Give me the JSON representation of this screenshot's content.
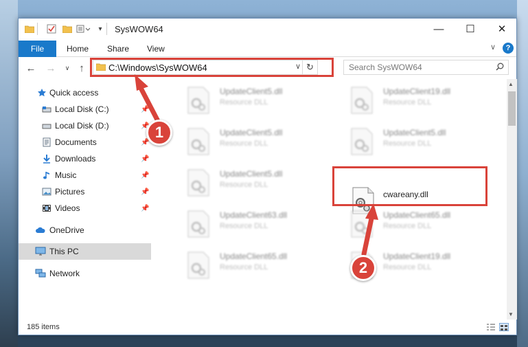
{
  "window": {
    "title": "SysWOW64",
    "controls": {
      "minimize": "—",
      "maximize": "☐",
      "close": "✕"
    }
  },
  "ribbon": {
    "file": "File",
    "tabs": [
      "Home",
      "Share",
      "View"
    ],
    "expand": "∨",
    "help": "?"
  },
  "nav": {
    "back": "←",
    "forward": "→",
    "recent": "∨",
    "up": "↑",
    "address": "C:\\Windows\\SysWOW64",
    "address_dropdown": "∨",
    "refresh": "↻",
    "search_placeholder": "Search SysWOW64"
  },
  "sidebar": {
    "items": [
      {
        "label": "Quick access",
        "icon": "star-icon",
        "pinned": false
      },
      {
        "label": "Local Disk (C:)",
        "icon": "drive-icon",
        "pinned": true
      },
      {
        "label": "Local Disk (D:)",
        "icon": "drive-icon",
        "pinned": true
      },
      {
        "label": "Documents",
        "icon": "documents-icon",
        "pinned": true
      },
      {
        "label": "Downloads",
        "icon": "download-icon",
        "pinned": true
      },
      {
        "label": "Music",
        "icon": "music-icon",
        "pinned": true
      },
      {
        "label": "Pictures",
        "icon": "pictures-icon",
        "pinned": true
      },
      {
        "label": "Videos",
        "icon": "videos-icon",
        "pinned": true
      },
      {
        "label": "OneDrive",
        "icon": "cloud-icon",
        "pinned": false
      },
      {
        "label": "This PC",
        "icon": "computer-icon",
        "pinned": false,
        "selected": true
      },
      {
        "label": "Network",
        "icon": "network-icon",
        "pinned": false
      }
    ],
    "pin_glyph": "📌"
  },
  "files": [
    {
      "name": "UpdateClient5.dll",
      "type": "Resource DLL",
      "blurred": true
    },
    {
      "name": "UpdateClient19.dll",
      "type": "Resource DLL",
      "blurred": true
    },
    {
      "name": "UpdateClient5.dll",
      "type": "Resource DLL",
      "blurred": true
    },
    {
      "name": "UpdateClient5.dll",
      "type": "Resource DLL",
      "blurred": true
    },
    {
      "name": "UpdateClient5.dll",
      "type": "Resource DLL",
      "blurred": true
    },
    {
      "name": "cwareany.dll",
      "type": "",
      "blurred": false
    },
    {
      "name": "UpdateClient63.dll",
      "type": "Resource DLL",
      "blurred": true
    },
    {
      "name": "UpdateClient65.dll",
      "type": "Resource DLL",
      "blurred": true
    },
    {
      "name": "UpdateClient65.dll",
      "type": "Resource DLL",
      "blurred": true
    },
    {
      "name": "UpdateClient19.dll",
      "type": "Resource DLL",
      "blurred": true
    }
  ],
  "status": {
    "items": "185 items"
  },
  "annotations": {
    "step1": "1",
    "step2": "2",
    "color": "#d9433a"
  },
  "colors": {
    "accent": "#1979ca",
    "highlight": "#d9433a",
    "selected_row": "#d9d9d9"
  }
}
